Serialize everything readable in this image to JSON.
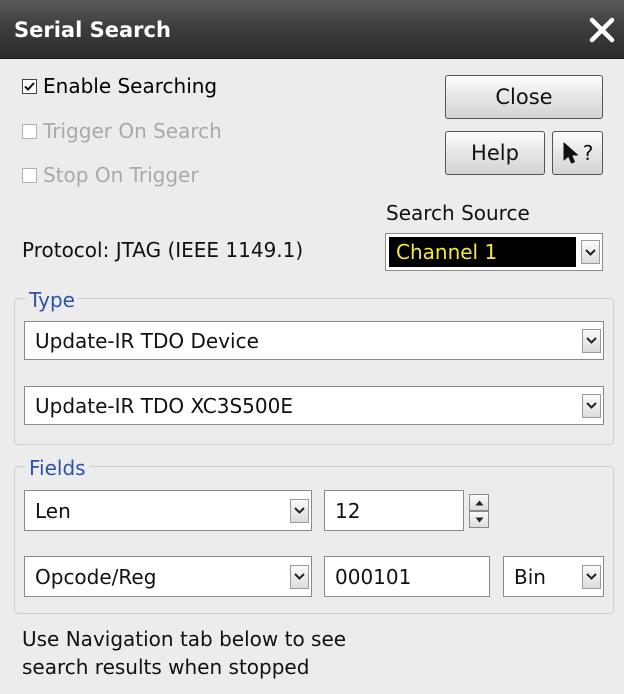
{
  "window": {
    "title": "Serial Search"
  },
  "options": {
    "enable_searching": {
      "label": "Enable Searching",
      "checked": true,
      "enabled": true
    },
    "trigger_on_search": {
      "label": "Trigger On Search",
      "checked": false,
      "enabled": false
    },
    "stop_on_trigger": {
      "label": "Stop On Trigger",
      "checked": false,
      "enabled": false
    }
  },
  "buttons": {
    "close_label": "Close",
    "help_label": "Help",
    "whats_this_label": "?"
  },
  "protocol": {
    "label": "Protocol: JTAG (IEEE 1149.1)"
  },
  "search_source": {
    "label": "Search Source",
    "value": "Channel 1",
    "value_color": "#f5e93a"
  },
  "type_group": {
    "title": "Type",
    "select1": "Update-IR TDO Device",
    "select2": "Update-IR TDO XC3S500E"
  },
  "fields_group": {
    "title": "Fields",
    "row1": {
      "field": "Len",
      "value": "12"
    },
    "row2": {
      "field": "Opcode/Reg",
      "value": "000101",
      "format": "Bin"
    }
  },
  "hint": {
    "line1": "Use Navigation tab below to see",
    "line2": "search results when stopped"
  }
}
